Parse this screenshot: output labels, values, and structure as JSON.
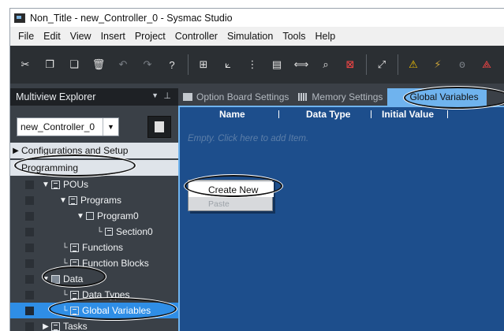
{
  "window": {
    "title": "Non_Title - new_Controller_0 - Sysmac Studio"
  },
  "menubar": {
    "items": [
      "File",
      "Edit",
      "View",
      "Insert",
      "Project",
      "Controller",
      "Simulation",
      "Tools",
      "Help"
    ]
  },
  "toolbar": {
    "buttons": [
      {
        "icon": "cut-icon",
        "glyph": "✂"
      },
      {
        "icon": "copy-icon",
        "glyph": "❐"
      },
      {
        "icon": "paste-icon",
        "glyph": "❏"
      },
      {
        "icon": "delete-icon",
        "glyph": "🗑"
      },
      {
        "icon": "undo-icon",
        "glyph": "↶"
      },
      {
        "icon": "redo-icon",
        "glyph": "↷"
      },
      {
        "icon": "help-icon",
        "glyph": "?"
      },
      {
        "icon": "window-icon",
        "glyph": "⊞"
      },
      {
        "icon": "arrow-icon",
        "glyph": "⟀"
      },
      {
        "icon": "tree-icon",
        "glyph": "⋮"
      },
      {
        "icon": "view-icon",
        "glyph": "▤"
      },
      {
        "icon": "compare-icon",
        "glyph": "⟺"
      },
      {
        "icon": "search-icon",
        "glyph": "⌕"
      },
      {
        "icon": "monitor-icon",
        "glyph": "⊠"
      },
      {
        "icon": "tool-icon",
        "glyph": "⤢"
      },
      {
        "icon": "warning-icon",
        "glyph": "⚠"
      },
      {
        "icon": "lock-icon",
        "glyph": "⚡"
      },
      {
        "icon": "key-icon",
        "glyph": "ꙩ"
      },
      {
        "icon": "error-icon",
        "glyph": "⟁"
      }
    ]
  },
  "explorer": {
    "title": "Multiview Explorer",
    "controller_select": "new_Controller_0",
    "tree": [
      {
        "label": "Configurations and Setup",
        "kind": "header"
      },
      {
        "label": "Programming",
        "kind": "header"
      },
      {
        "label": "POUs",
        "kind": "dark"
      },
      {
        "label": "Programs",
        "kind": "dark"
      },
      {
        "label": "Program0",
        "kind": "dark"
      },
      {
        "label": "Section0",
        "kind": "dark"
      },
      {
        "label": "Functions",
        "kind": "dark"
      },
      {
        "label": "Function Blocks",
        "kind": "dark"
      },
      {
        "label": "Data",
        "kind": "dark"
      },
      {
        "label": "Data Types",
        "kind": "dark"
      },
      {
        "label": "Global Variables",
        "kind": "selected"
      },
      {
        "label": "Tasks",
        "kind": "dark"
      }
    ]
  },
  "tabs": [
    {
      "label": "Option Board Settings"
    },
    {
      "label": "Memory Settings"
    },
    {
      "label": "Global Variables",
      "active": true
    }
  ],
  "editor": {
    "columns": [
      "Name",
      "Data Type",
      "Initial Value"
    ],
    "empty_hint": "Empty. Click here to add Item.",
    "context_menu": {
      "create_new": "Create New",
      "paste": "Paste"
    }
  },
  "colors": {
    "accent": "#2f8ee6",
    "tab_active": "#6fb3ee",
    "editor_bg": "#1d4e8c",
    "toolbar_bg": "#2b2f33",
    "panel_bg": "#3a4047"
  }
}
